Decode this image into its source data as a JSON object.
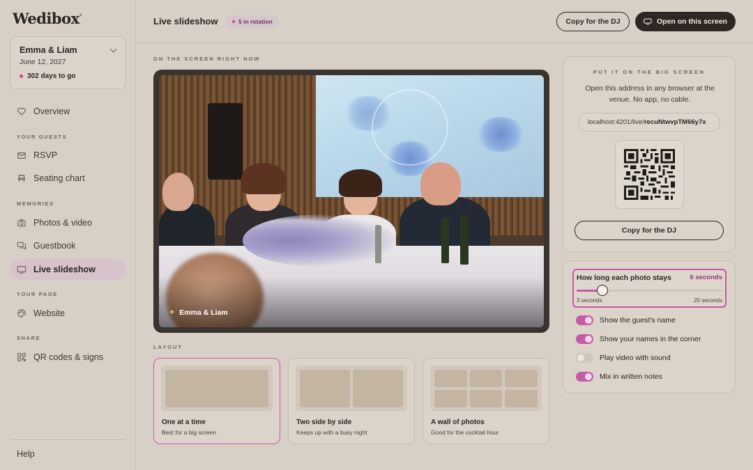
{
  "brand": {
    "logo": "Wedibox"
  },
  "event": {
    "names": "Emma & Liam",
    "date": "June 12, 2027",
    "countdown": "302 days to go"
  },
  "nav": {
    "overview": "Overview",
    "section_guests": "YOUR GUESTS",
    "rsvp": "RSVP",
    "seating": "Seating chart",
    "section_memories": "MEMORIES",
    "photos": "Photos & video",
    "guestbook": "Guestbook",
    "slideshow": "Live slideshow",
    "section_page": "YOUR PAGE",
    "website": "Website",
    "section_share": "SHARE",
    "qr": "QR codes & signs",
    "help": "Help"
  },
  "header": {
    "title": "Live slideshow",
    "badge": "5 in rotation",
    "copy_button": "Copy for the DJ",
    "open_button": "Open on this screen"
  },
  "preview": {
    "section_label": "ON THE SCREEN RIGHT NOW",
    "caption": "Emma & Liam"
  },
  "layout": {
    "section_label": "LAYOUT",
    "options": [
      {
        "title": "One at a time",
        "subtitle": "Best for a big screen",
        "selected": true
      },
      {
        "title": "Two side by side",
        "subtitle": "Keeps up with a busy night",
        "selected": false
      },
      {
        "title": "A wall of photos",
        "subtitle": "Good for the cocktail hour",
        "selected": false
      }
    ]
  },
  "big_screen": {
    "heading": "PUT IT ON THE BIG SCREEN",
    "description": "Open this address in any browser at the venue. No app, no cable.",
    "url_prefix": "localhost:4201/live/",
    "url_code": "recuNtwvpTM66y7x",
    "copy_button": "Copy for the DJ"
  },
  "settings": {
    "duration": {
      "label": "How long each photo stays",
      "value_text": "6 seconds",
      "min_label": "3 seconds",
      "max_label": "20 seconds",
      "min": 3,
      "max": 20,
      "value": 6
    },
    "toggles": [
      {
        "label": "Show the guest's name",
        "on": true
      },
      {
        "label": "Show your names in the corner",
        "on": true
      },
      {
        "label": "Play video with sound",
        "on": false
      },
      {
        "label": "Mix in written notes",
        "on": true
      }
    ]
  },
  "colors": {
    "accent": "#c65aa5",
    "dark": "#2d2622",
    "background": "#d8d0c7"
  }
}
